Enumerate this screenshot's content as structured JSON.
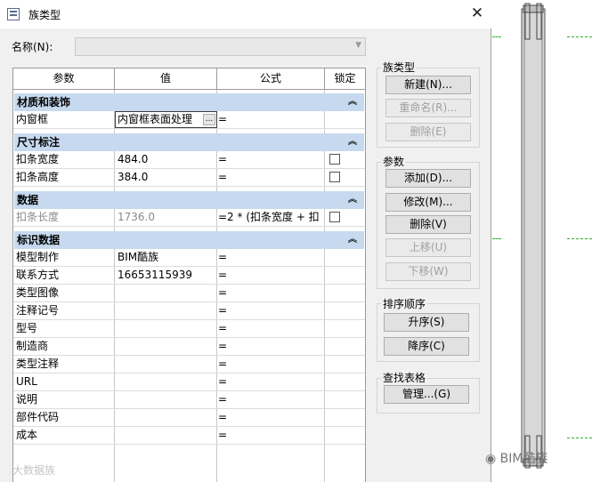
{
  "window": {
    "title": "族类型",
    "close_glyph": "✕"
  },
  "name_field": {
    "label": "名称(N):",
    "value": ""
  },
  "columns": {
    "param": "参数",
    "value": "值",
    "formula": "公式",
    "lock": "锁定"
  },
  "groups": [
    {
      "title": "材质和装饰",
      "rows": [
        {
          "param": "内窗框",
          "value": "内窗框表面处理",
          "formula": "=",
          "editing": true
        }
      ]
    },
    {
      "title": "尺寸标注",
      "rows": [
        {
          "param": "扣条宽度",
          "value": "484.0",
          "formula": "=",
          "lock": true
        },
        {
          "param": "扣条高度",
          "value": "384.0",
          "formula": "=",
          "lock": true
        }
      ]
    },
    {
      "title": "数据",
      "rows": [
        {
          "param": "扣条长度",
          "value": "1736.0",
          "formula": "=2 * (扣条宽度 + 扣",
          "lock": true,
          "disabled": true
        }
      ]
    },
    {
      "title": "标识数据",
      "rows": [
        {
          "param": "模型制作",
          "value": "BIM酷族",
          "formula": "="
        },
        {
          "param": "联系方式",
          "value": "16653115939",
          "formula": "="
        },
        {
          "param": "类型图像",
          "value": "",
          "formula": "="
        },
        {
          "param": "注释记号",
          "value": "",
          "formula": "="
        },
        {
          "param": "型号",
          "value": "",
          "formula": "="
        },
        {
          "param": "制造商",
          "value": "",
          "formula": "="
        },
        {
          "param": "类型注释",
          "value": "",
          "formula": "="
        },
        {
          "param": "URL",
          "value": "",
          "formula": "="
        },
        {
          "param": "说明",
          "value": "",
          "formula": "="
        },
        {
          "param": "部件代码",
          "value": "",
          "formula": "="
        },
        {
          "param": "成本",
          "value": "",
          "formula": "="
        }
      ]
    }
  ],
  "family_types": {
    "title": "族类型",
    "new": "新建(N)...",
    "rename": "重命名(R)...",
    "delete": "删除(E)"
  },
  "parameters": {
    "title": "参数",
    "add": "添加(D)...",
    "modify": "修改(M)...",
    "delete": "删除(V)",
    "move_up": "上移(U)",
    "move_down": "下移(W)"
  },
  "sort": {
    "title": "排序顺序",
    "asc": "升序(S)",
    "desc": "降序(C)"
  },
  "lookup": {
    "title": "查找表格",
    "manage": "管理...(G)"
  },
  "watermarks": {
    "left": "大数据族",
    "right": "BIM酷族"
  },
  "colors": {
    "group_header": "#c6d9ef",
    "dialog_bg": "#f0f0f0",
    "ref_line": "#2db02d"
  }
}
